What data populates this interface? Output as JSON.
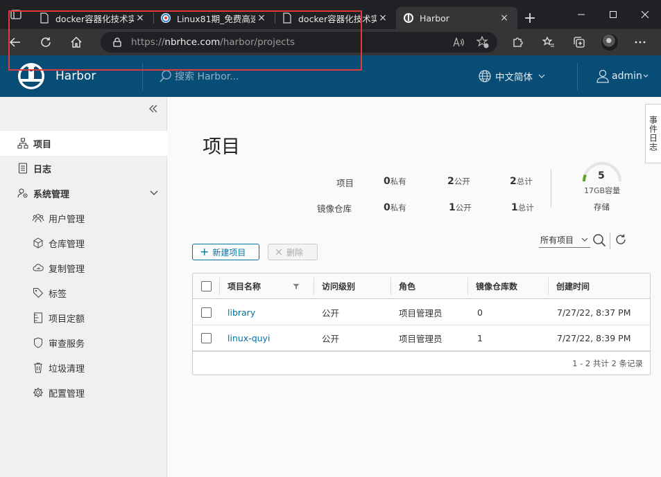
{
  "browser": {
    "tabs": [
      {
        "title": "docker容器化技术实",
        "close": "×"
      },
      {
        "title": "Linux81期_免费高速",
        "close": "×"
      },
      {
        "title": "docker容器化技术实",
        "close": "×"
      },
      {
        "title": "Harbor",
        "close": "×"
      }
    ],
    "new_tab": "+",
    "url_prefix": "https://",
    "url_host": "nbrhce.com",
    "url_path": "/harbor/projects"
  },
  "header": {
    "brand": "Harbor",
    "search_placeholder": "搜索 Harbor...",
    "language": "中文简体",
    "user": "admin"
  },
  "sidebar": {
    "items": [
      {
        "label": "项目"
      },
      {
        "label": "日志"
      },
      {
        "label": "系统管理"
      },
      {
        "label": "用户管理"
      },
      {
        "label": "仓库管理"
      },
      {
        "label": "复制管理"
      },
      {
        "label": "标签"
      },
      {
        "label": "项目定额"
      },
      {
        "label": "审查服务"
      },
      {
        "label": "垃圾清理"
      },
      {
        "label": "配置管理"
      }
    ]
  },
  "main": {
    "title": "项目",
    "stats": {
      "projects_label": "项目",
      "repos_label": "镜像仓库",
      "projects": {
        "private": "0",
        "private_label": "私有",
        "public": "2",
        "public_label": "公开",
        "total": "2",
        "total_label": "总计"
      },
      "repos": {
        "private": "0",
        "private_label": "私有",
        "public": "1",
        "public_label": "公开",
        "total": "1",
        "total_label": "总计"
      },
      "storage_count": "5",
      "capacity": "17GB容量",
      "storage_label": "存储",
      "usage_fraction": 0.12
    },
    "filter_label": "所有项目",
    "new_project": "新建项目",
    "delete": "删除",
    "columns": [
      "项目名称",
      "访问级别",
      "角色",
      "镜像仓库数",
      "创建时间"
    ],
    "rows": [
      {
        "name": "library",
        "access": "公开",
        "role": "项目管理员",
        "repos": "0",
        "created": "7/27/22, 8:37 PM"
      },
      {
        "name": "linux-quyi",
        "access": "公开",
        "role": "项目管理员",
        "repos": "1",
        "created": "7/27/22, 8:39 PM"
      }
    ],
    "footer": "1 - 2 共计 2 条记录"
  },
  "event_tab": "事件日志",
  "colors": {
    "header": "#074d76",
    "link": "#0072a3",
    "highlight": "#e0393e"
  }
}
